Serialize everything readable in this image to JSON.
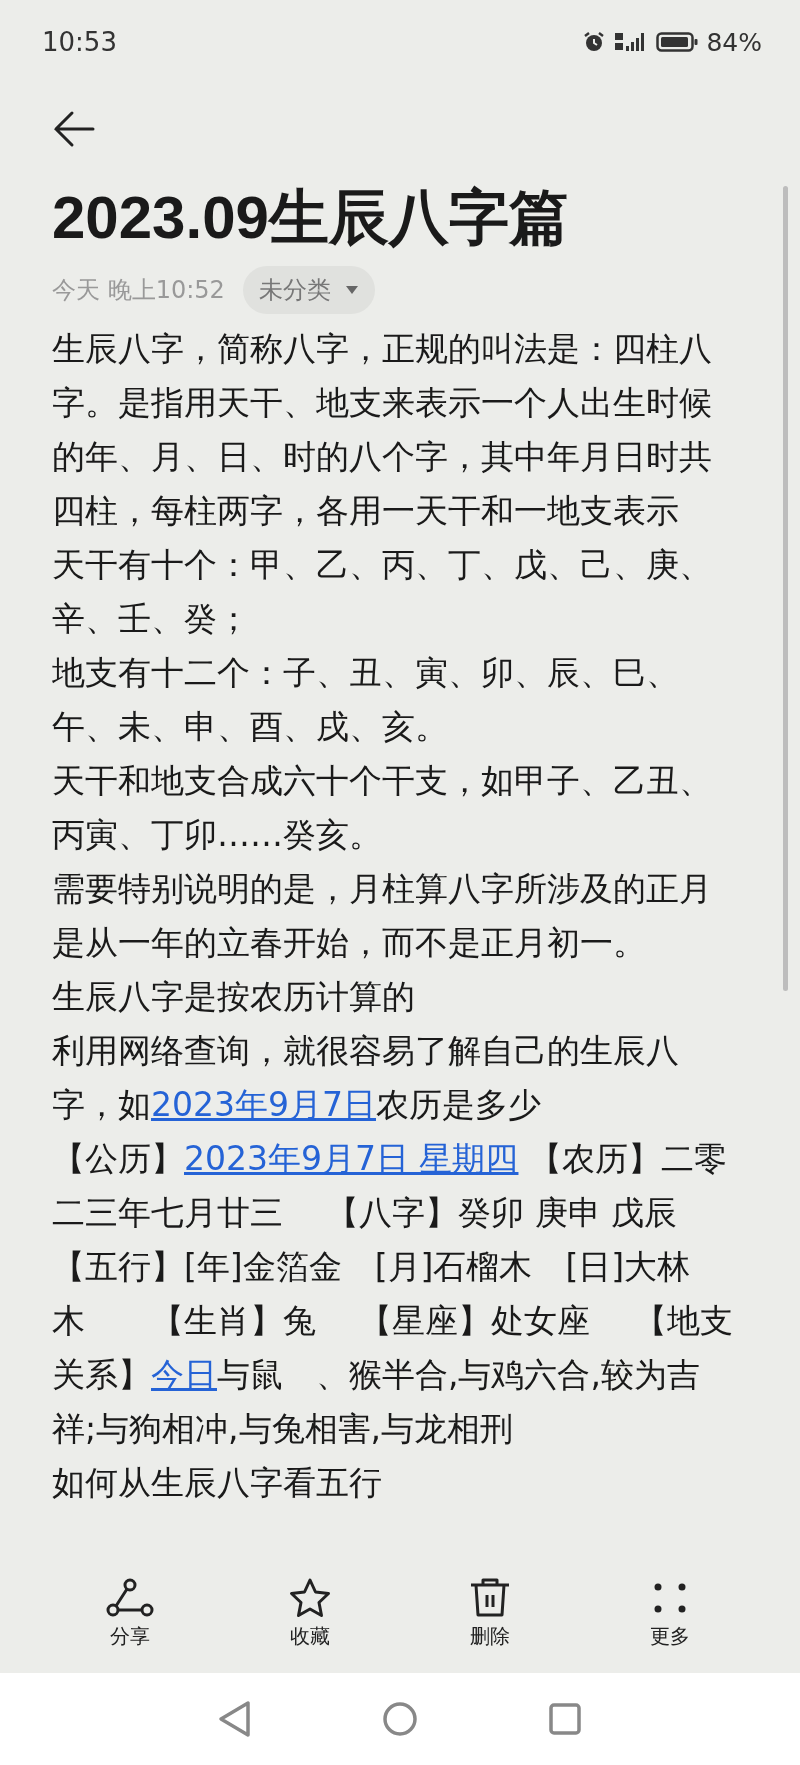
{
  "status_bar": {
    "time": "10:53",
    "battery": "84%"
  },
  "title": "2023.09生辰八字篇",
  "meta": {
    "date": "今天 晚上10:52",
    "category": "未分类"
  },
  "body": [
    [
      {
        "text": "生辰八字，简称八字，正规的叫法是：四柱八字。是指用天干、地支来表示一个人出生时候的年、月、日、时的八个字，其中年月日时共四柱，每柱两字，各用一天干和一地支表示",
        "link": false
      }
    ],
    [
      {
        "text": "天干有十个：甲、乙、丙、丁、戊、己、庚、辛、壬、癸；",
        "link": false
      }
    ],
    [
      {
        "text": "地支有十二个：子、丑、寅、卯、辰、巳、午、未、申、酉、戌、亥。",
        "link": false
      }
    ],
    [
      {
        "text": "天干和地支合成六十个干支，如甲子、乙丑、丙寅、丁卯……癸亥。",
        "link": false
      }
    ],
    [
      {
        "text": "需要特别说明的是，月柱算八字所涉及的正月是从一年的立春开始，而不是正月初一。",
        "link": false
      }
    ],
    [
      {
        "text": "生辰八字是按农历计算的",
        "link": false
      }
    ],
    [
      {
        "text": "利用网络查询，就很容易了解自己的生辰八字，如",
        "link": false
      },
      {
        "text": "2023年9月7日",
        "link": true
      },
      {
        "text": "农历是多少",
        "link": false
      }
    ],
    [
      {
        "text": "【公历】",
        "link": false
      },
      {
        "text": "2023年9月7日 星期四",
        "link": true
      },
      {
        "text": " 【农历】二零二三年七月廿三　 【八字】癸卯 庚申 戊辰【五行】[年]金箔金　[月]石榴木　[日]大林木　　【生肖】兔　 【星座】处女座　 【地支关系】",
        "link": false
      },
      {
        "text": "今日",
        "link": true
      },
      {
        "text": "与鼠　、猴半合,与鸡六合,较为吉祥;与狗相冲,与兔相害,与龙相刑",
        "link": false
      }
    ],
    [
      {
        "text": "如何从生辰八字看五行",
        "link": false
      }
    ]
  ],
  "toolbar": [
    {
      "kind": "share",
      "label": "分享"
    },
    {
      "kind": "star",
      "label": "收藏"
    },
    {
      "kind": "delete",
      "label": "删除"
    },
    {
      "kind": "more",
      "label": "更多"
    }
  ]
}
